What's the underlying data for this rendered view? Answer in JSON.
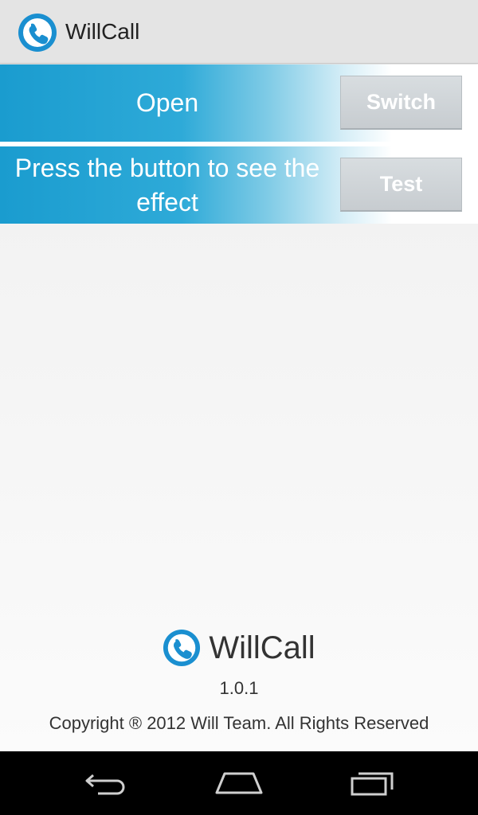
{
  "app": {
    "title": "WillCall",
    "icon": "phone-handset-icon",
    "accent_color": "#1a8fd0"
  },
  "rows": [
    {
      "label": "Open",
      "button_label": "Switch"
    },
    {
      "label": "Press the button to see the effect",
      "button_label": "Test"
    }
  ],
  "about": {
    "name": "WillCall",
    "version": "1.0.1",
    "copyright": "Copyright ® 2012 Will Team. All Rights Reserved"
  },
  "nav": {
    "back_icon": "back-arrow-icon",
    "home_icon": "home-icon",
    "recents_icon": "recent-apps-icon"
  }
}
